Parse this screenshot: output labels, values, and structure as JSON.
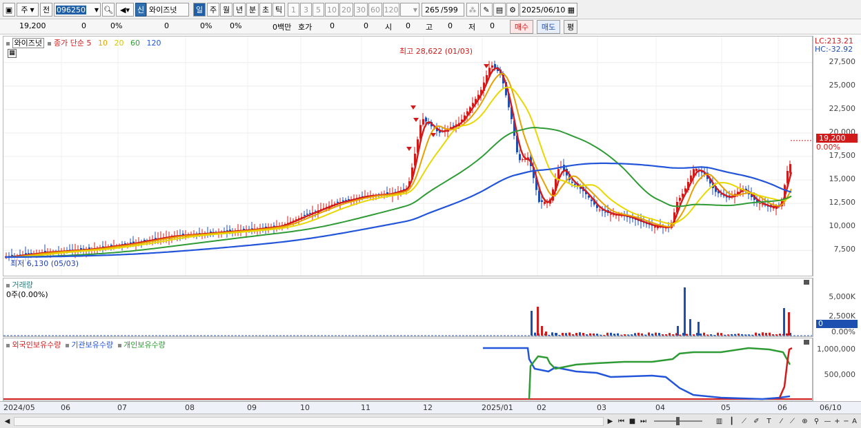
{
  "toolbar": {
    "period_label": "주",
    "prev_label": "전",
    "code": "096250",
    "market_badge": "신",
    "stock_name": "와이즈넛",
    "tf_day": "일",
    "tf_week": "주",
    "tf_month": "월",
    "tf_year": "년",
    "tf_min": "분",
    "tf_sec": "초",
    "tf_tick": "틱",
    "intervals": [
      "1",
      "3",
      "5",
      "10",
      "20",
      "30",
      "60",
      "120"
    ],
    "count": "265",
    "total": "/599",
    "date": "2025/06/10"
  },
  "inforow": {
    "price": "19,200",
    "change": "0",
    "change_pct": "0%",
    "val2": "0",
    "pct2": "0%",
    "pct3": "0%",
    "amount": "0백만",
    "quote_label": "호가",
    "quote_val1": "0",
    "quote_val2": "0",
    "open_label": "시",
    "open_val": "0",
    "high_label": "고",
    "high_val": "0",
    "low_label": "저",
    "low_val": "0",
    "buy_label": "매수",
    "sell_label": "매도",
    "eval_label": "평"
  },
  "price_panel": {
    "legend_name": "와이즈넛",
    "legend_ma": "종가 단순",
    "ma_periods": [
      "5",
      "10",
      "20",
      "60",
      "120"
    ],
    "ma_colors": [
      "#d11a1a",
      "#e8a000",
      "#e8d800",
      "#2e9b35",
      "#2255d9"
    ],
    "lc": "LC:213.21",
    "hc": "HC:-32.92",
    "current_price": "19,200",
    "current_pct": "0.00%",
    "high_note": "최고 28,622 (01/03)",
    "low_note": "최저 6,130 (05/03)",
    "yticks": [
      "27,500",
      "25,000",
      "22,500",
      "20,000",
      "17,500",
      "15,000",
      "12,500",
      "10,000",
      "7,500"
    ]
  },
  "volume_panel": {
    "title": "거래량",
    "value": "0주(0.00%)",
    "yticks": [
      "5,000K",
      "2,500K",
      "0.00%"
    ],
    "current": "0"
  },
  "holdings_panel": {
    "legend": [
      "외국인보유수량",
      "기관보유수량",
      "개인보유수량"
    ],
    "legend_colors": [
      "#d11a1a",
      "#2255d9",
      "#2e9b35"
    ],
    "yticks": [
      "1,000,000",
      "500,000"
    ]
  },
  "xaxis": {
    "labels": [
      "2024/05",
      "06",
      "07",
      "08",
      "09",
      "10",
      "11",
      "12",
      "2025/01",
      "02",
      "03",
      "04",
      "05",
      "06",
      "06/10"
    ]
  },
  "chart_data": {
    "type": "line",
    "x": [
      "2024/05",
      "06",
      "07",
      "08",
      "09",
      "10",
      "11",
      "12",
      "2025/01",
      "02",
      "03",
      "04",
      "05",
      "06"
    ],
    "series": [
      {
        "values": [
          6800,
          7300,
          8000,
          8500,
          9500,
          11500,
          13500,
          23000,
          27000,
          12500,
          11200,
          10000,
          13000,
          12500
        ]
      }
    ],
    "ylim": [
      6000,
      28622
    ],
    "annotations": [
      "최고 28,622 (01/03)",
      "최저 6,130 (05/03)"
    ]
  }
}
